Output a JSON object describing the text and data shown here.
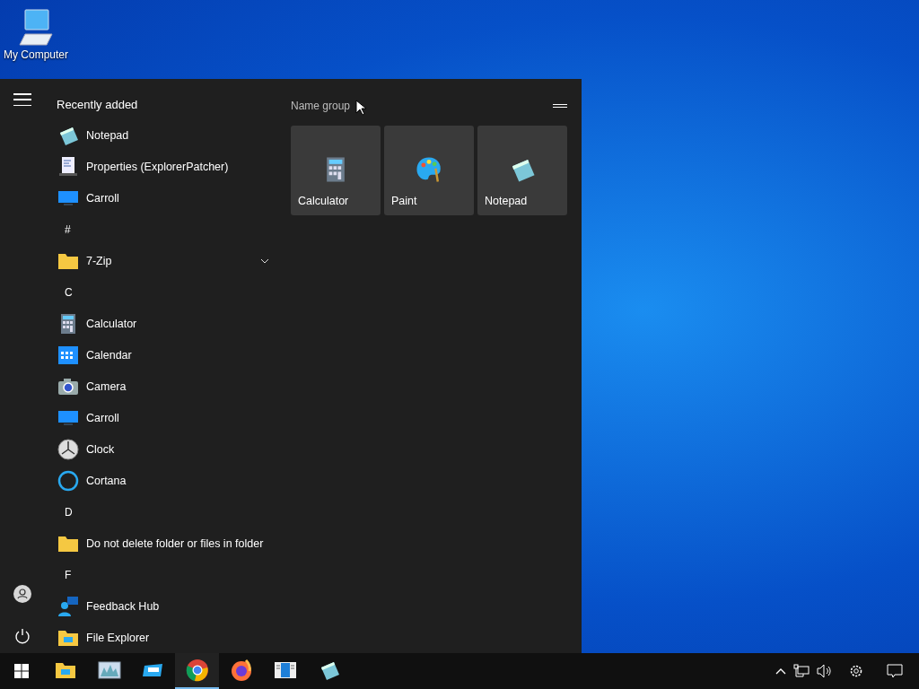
{
  "desktop": {
    "icons": [
      {
        "label": "My Computer"
      }
    ]
  },
  "start_menu": {
    "list_header": "Recently added",
    "items": [
      {
        "kind": "app",
        "label": "Notepad",
        "expandable": false
      },
      {
        "kind": "app",
        "label": "Properties (ExplorerPatcher)",
        "expandable": false
      },
      {
        "kind": "app",
        "label": "Carroll",
        "expandable": false
      },
      {
        "kind": "header",
        "label": "#"
      },
      {
        "kind": "app",
        "label": "7-Zip",
        "expandable": true
      },
      {
        "kind": "header",
        "label": "C"
      },
      {
        "kind": "app",
        "label": "Calculator",
        "expandable": false
      },
      {
        "kind": "app",
        "label": "Calendar",
        "expandable": false
      },
      {
        "kind": "app",
        "label": "Camera",
        "expandable": false
      },
      {
        "kind": "app",
        "label": "Carroll",
        "expandable": false
      },
      {
        "kind": "app",
        "label": "Clock",
        "expandable": false
      },
      {
        "kind": "app",
        "label": "Cortana",
        "expandable": false
      },
      {
        "kind": "header",
        "label": "D"
      },
      {
        "kind": "app",
        "label": "Do not delete folder or files in folder",
        "expandable": false
      },
      {
        "kind": "header",
        "label": "F"
      },
      {
        "kind": "app",
        "label": "Feedback Hub",
        "expandable": false
      },
      {
        "kind": "app",
        "label": "File Explorer",
        "expandable": false
      }
    ],
    "tile_group": {
      "title": "Name group",
      "tiles": [
        {
          "label": "Calculator"
        },
        {
          "label": "Paint"
        },
        {
          "label": "Notepad"
        }
      ]
    }
  },
  "taskbar": {
    "apps": [
      {
        "selected": false
      },
      {
        "selected": false
      },
      {
        "selected": false
      },
      {
        "selected": true
      },
      {
        "selected": false
      },
      {
        "selected": false
      },
      {
        "selected": false
      }
    ]
  }
}
